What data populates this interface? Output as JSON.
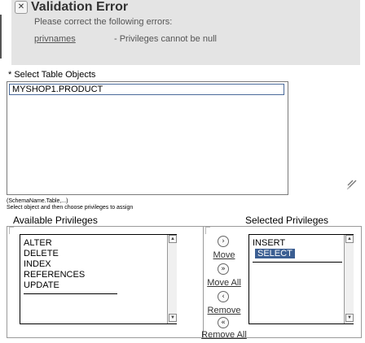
{
  "validation": {
    "title": "Validation Error",
    "message": "Please correct the following errors:",
    "field_name": "privnames",
    "field_error": " - Privileges cannot be null",
    "truncated_line": "- Privileges cannot be null"
  },
  "table_objects": {
    "label": "* Select Table Objects",
    "selected": "MYSHOP1.PRODUCT"
  },
  "help": {
    "syntax": "(SchemaName.Table,...)",
    "hint": "Select object and then choose privileges to assign"
  },
  "available": {
    "heading": "Available Privileges",
    "items": [
      "ALTER",
      "DELETE",
      "INDEX",
      "REFERENCES",
      "UPDATE"
    ]
  },
  "shuttle": {
    "move": "Move",
    "move_all": "Move All",
    "remove": "Remove",
    "remove_all": "Remove All"
  },
  "selected": {
    "heading": "Selected Privileges",
    "items": [
      "INSERT",
      "SELECT"
    ]
  },
  "icons": {
    "error": "close-circle-icon",
    "move": "move-right-icon",
    "move_all": "move-all-right-icon",
    "remove": "move-left-icon",
    "remove_all": "move-all-left-icon",
    "resize": "resize-grip-icon"
  }
}
